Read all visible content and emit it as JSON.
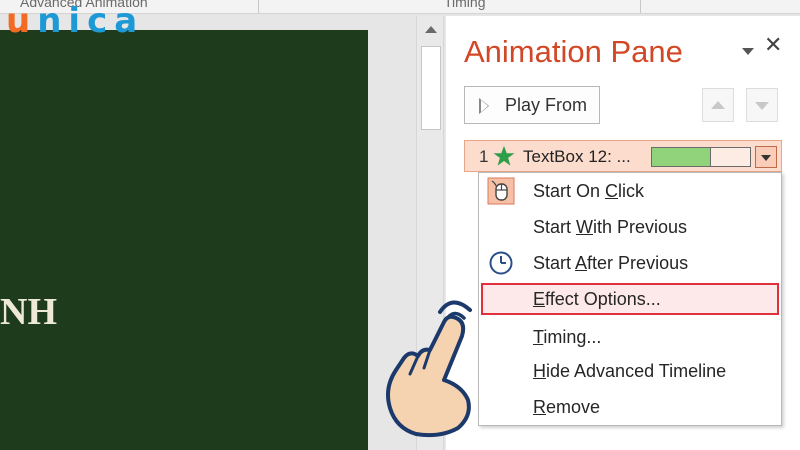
{
  "ribbon": {
    "left_label": "Advanced Animation",
    "right_label": "Timing"
  },
  "logo": {
    "first_letter": "u",
    "rest": "nica",
    "colors": {
      "u": "#f26b23",
      "rest": "#1d9ad6"
    }
  },
  "slide": {
    "text": "NH",
    "background": "#1e3b1b"
  },
  "pane": {
    "title": "Animation Pane",
    "title_color": "#d24726",
    "close_symbol": "✕",
    "play_from_label": "Play From",
    "animation_item": {
      "number": "1",
      "name": "TextBox 12: ...",
      "effect_icon": "green-star-icon",
      "timeline_progress": 0.6,
      "timeline_fill_color": "#90d37b"
    }
  },
  "context_menu": {
    "items": [
      {
        "pre": "Start On ",
        "key": "C",
        "post": "lick",
        "icon": "mouse-click-icon",
        "highlighted": false
      },
      {
        "pre": "Start ",
        "key": "W",
        "post": "ith Previous",
        "icon": "",
        "highlighted": false
      },
      {
        "pre": "Start ",
        "key": "A",
        "post": "fter Previous",
        "icon": "clock-icon",
        "highlighted": false
      },
      {
        "pre": "",
        "key": "E",
        "post": "ffect Options...",
        "icon": "",
        "highlighted": true
      },
      {
        "pre": "",
        "key": "T",
        "post": "iming...",
        "icon": "",
        "highlighted": false
      },
      {
        "pre": "",
        "key": "H",
        "post": "ide Advanced Timeline",
        "icon": "",
        "highlighted": false
      },
      {
        "pre": "",
        "key": "R",
        "post": "emove",
        "icon": "",
        "highlighted": false
      }
    ],
    "highlight_color": "#e0303c"
  },
  "cursor": {
    "icon": "pointing-hand-icon"
  }
}
